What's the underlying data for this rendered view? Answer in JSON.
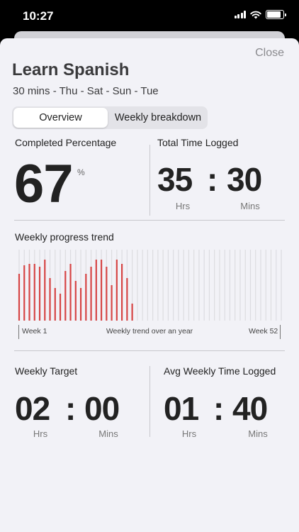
{
  "status_bar": {
    "time": "10:27"
  },
  "sheet": {
    "close_label": "Close",
    "title": "Learn Spanish",
    "subtitle": "30 mins - Thu - Sat - Sun - Tue"
  },
  "tabs": [
    {
      "label": "Overview",
      "active": true
    },
    {
      "label": "Weekly breakdown",
      "active": false
    }
  ],
  "completed": {
    "label": "Completed Percentage",
    "value": "67",
    "unit": "%"
  },
  "total_time": {
    "label": "Total Time Logged",
    "hours": "35",
    "minutes": "30",
    "hours_label": "Hrs",
    "minutes_label": "Mins"
  },
  "weekly_trend": {
    "label": "Weekly progress trend",
    "start_label": "Week 1",
    "center_label": "Weekly trend over an year",
    "end_label": "Week 52"
  },
  "weekly_target": {
    "label": "Weekly Target",
    "hours": "02",
    "minutes": "00",
    "hours_label": "Hrs",
    "minutes_label": "Mins"
  },
  "avg_weekly": {
    "label": "Avg Weekly Time Logged",
    "hours": "01",
    "minutes": "40",
    "hours_label": "Hrs",
    "minutes_label": "Mins"
  },
  "chart_data": {
    "type": "bar",
    "weeks": 52,
    "values": [
      0.66,
      0.78,
      0.8,
      0.8,
      0.76,
      0.86,
      0.6,
      0.46,
      0.38,
      0.7,
      0.8,
      0.56,
      0.46,
      0.66,
      0.76,
      0.86,
      0.86,
      0.76,
      0.5,
      0.86,
      0.8,
      0.6,
      0.24,
      0,
      0,
      0,
      0,
      0,
      0,
      0,
      0,
      0,
      0,
      0,
      0,
      0,
      0,
      0,
      0,
      0,
      0,
      0,
      0,
      0,
      0,
      0,
      0,
      0,
      0,
      0,
      0,
      0
    ],
    "ylim": [
      0,
      1
    ],
    "grid": true,
    "colors": {
      "bar": "#d64545",
      "grid": "#dcdce0"
    }
  }
}
